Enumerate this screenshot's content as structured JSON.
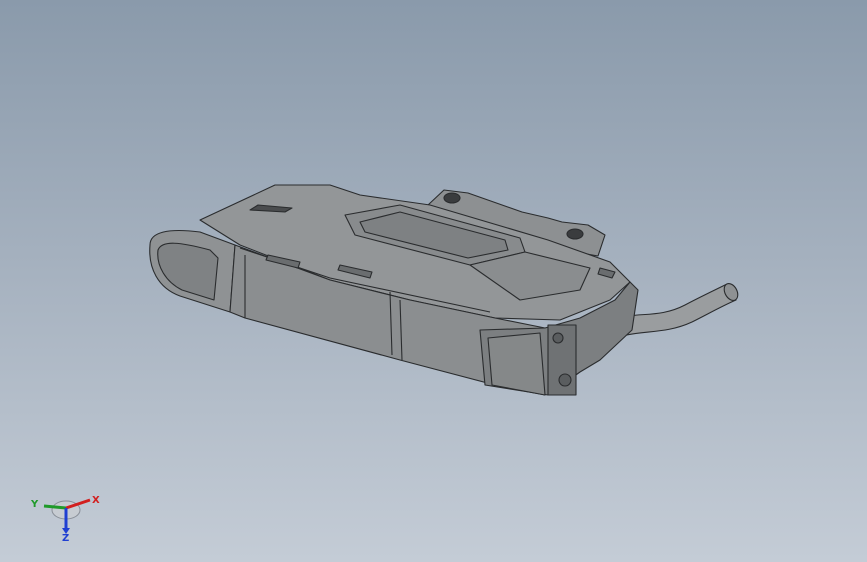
{
  "viewport": {
    "background_top": "#8a9aab",
    "background_bottom": "#c4ccd6",
    "model": {
      "part": "fiber-amplifier-sensor-housing",
      "body_color": "#8c8f91",
      "edge_color": "#2a2c2e",
      "cable_color": "#9a9d9f"
    }
  },
  "triad": {
    "x_label": "X",
    "y_label": "Y",
    "z_label": "Z",
    "x_color": "#d21f1f",
    "y_color": "#1f9a2a",
    "z_color": "#1f3fd2"
  }
}
